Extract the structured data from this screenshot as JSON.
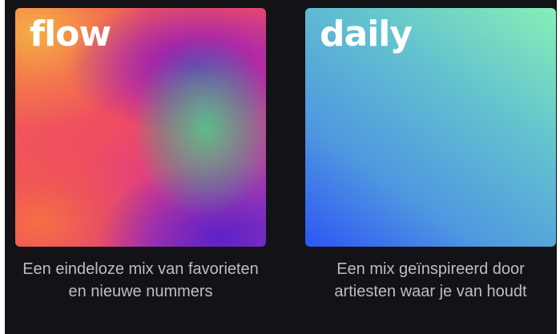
{
  "cards": [
    {
      "cover_title": "flow",
      "caption": "Een eindeloze mix van favorieten en nieuwe nummers"
    },
    {
      "cover_title": "daily",
      "caption": "Een mix geïnspireerd door artiesten waar je van houdt"
    }
  ]
}
